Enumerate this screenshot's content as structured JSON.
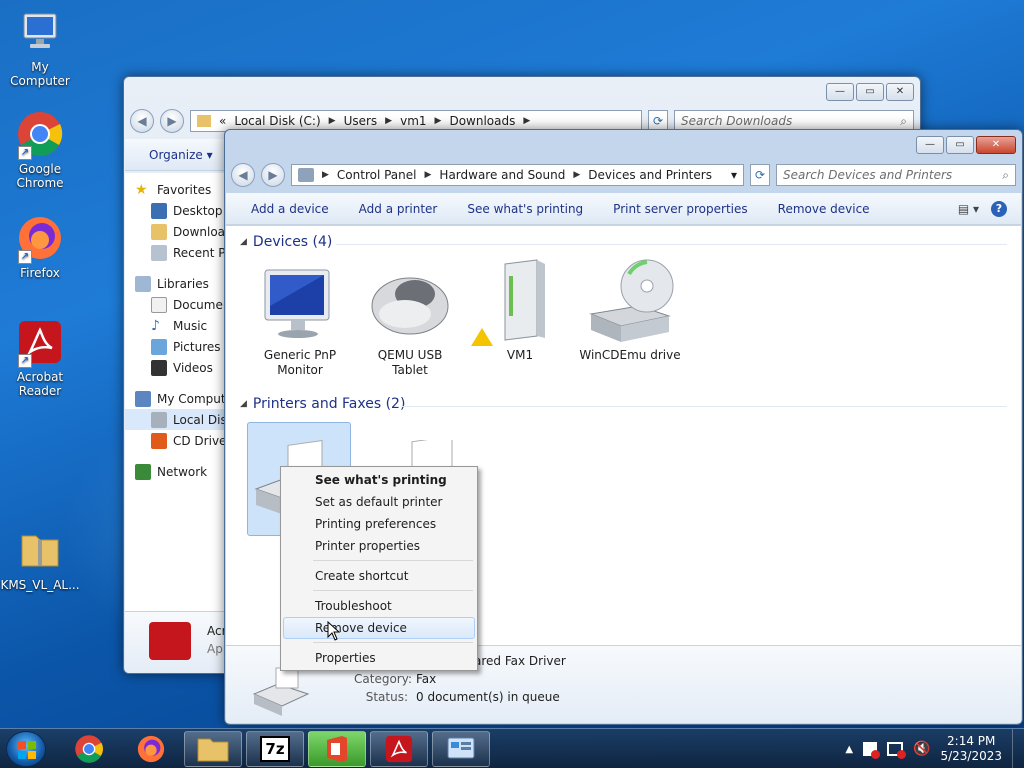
{
  "desktop": {
    "icons": [
      {
        "label": "My Computer"
      },
      {
        "label": "Google Chrome"
      },
      {
        "label": "Firefox"
      },
      {
        "label": "Acrobat Reader"
      },
      {
        "label": "KMS_VL_AL..."
      }
    ]
  },
  "explorer_back": {
    "address": [
      "Local Disk (C:)",
      "Users",
      "vm1",
      "Downloads"
    ],
    "address_prefix": "«",
    "search_placeholder": "Search Downloads",
    "organize": "Organize",
    "nav": [
      {
        "label": "Favorites"
      },
      {
        "label": "Desktop"
      },
      {
        "label": "Downloads"
      },
      {
        "label": "Recent Places"
      },
      {
        "label": "Libraries"
      },
      {
        "label": "Documents"
      },
      {
        "label": "Music"
      },
      {
        "label": "Pictures"
      },
      {
        "label": "Videos"
      },
      {
        "label": "My Computer"
      },
      {
        "label": "Local Disk (C:)"
      },
      {
        "label": "CD Drive"
      },
      {
        "label": "Network"
      }
    ],
    "details_title": "Acrobat Reader",
    "details_sub": "Application"
  },
  "devices_window": {
    "address": [
      "Control Panel",
      "Hardware and Sound",
      "Devices and Printers"
    ],
    "search_placeholder": "Search Devices and Printers",
    "commands": [
      "Add a device",
      "Add a printer",
      "See what's printing",
      "Print server properties",
      "Remove device"
    ],
    "groups": {
      "devices": "Devices (4)",
      "printers": "Printers and Faxes (2)"
    },
    "devices": [
      {
        "name": "Generic PnP Monitor"
      },
      {
        "name": "QEMU USB Tablet"
      },
      {
        "name": "VM1"
      },
      {
        "name": "WinCDEmu drive"
      }
    ],
    "details": {
      "driver": "Microsoft Shared Fax Driver",
      "driver_visible": "ared Fax Driver",
      "category_label": "Category:",
      "category_value": "Fax",
      "status_label": "Status:",
      "status_value": "0 document(s) in queue"
    }
  },
  "context_menu": {
    "items": [
      {
        "label": "See what's printing"
      },
      {
        "label": "Set as default printer"
      },
      {
        "label": "Printing preferences"
      },
      {
        "label": "Printer properties"
      },
      {
        "label": "Create shortcut"
      },
      {
        "label": "Troubleshoot"
      },
      {
        "label": "Remove device"
      },
      {
        "label": "Properties"
      }
    ]
  },
  "taskbar": {
    "time": "2:14 PM",
    "date": "5/23/2023",
    "sevenzip": "7z"
  },
  "colors": {
    "link_blue": "#1e3287",
    "close_red": "#c9462c",
    "selection": "#cce3fa"
  }
}
